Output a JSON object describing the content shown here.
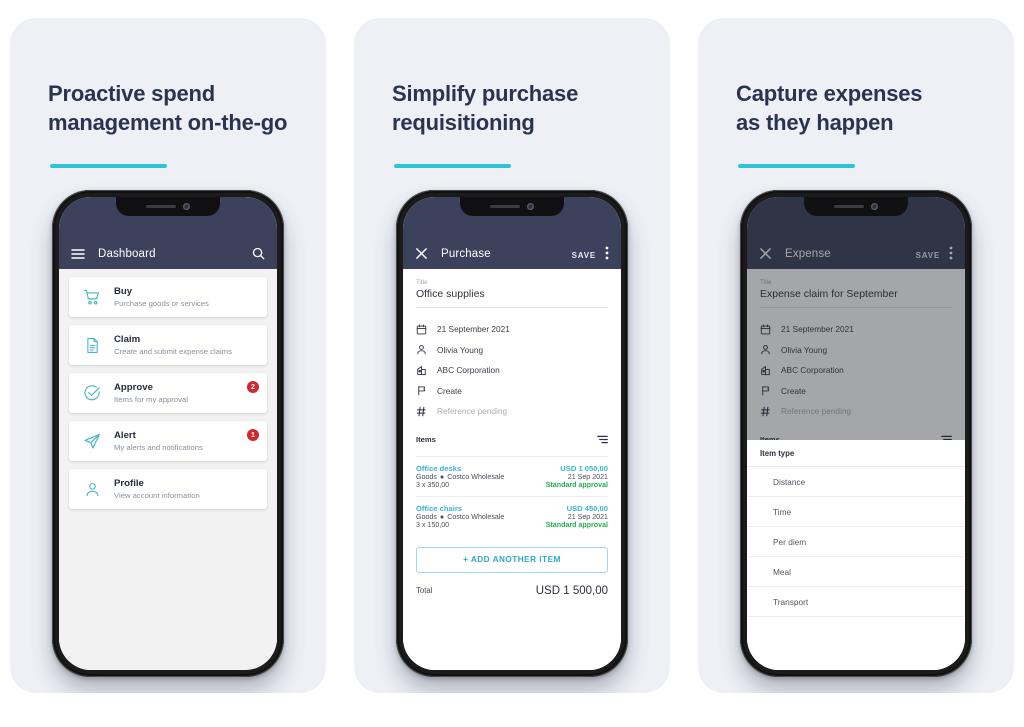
{
  "panels": [
    {
      "headline": "Proactive spend\nmanagement on-the-go",
      "screen": "dashboard",
      "appbar": {
        "title": "Dashboard",
        "menu_icon": "hamburger-icon",
        "search_icon": "search-icon"
      },
      "cards": [
        {
          "icon": "shopping-cart-icon",
          "title": "Buy",
          "subtitle": "Purchase goods or services",
          "badge": ""
        },
        {
          "icon": "document-icon",
          "title": "Claim",
          "subtitle": "Create and submit expense claims",
          "badge": ""
        },
        {
          "icon": "check-circle-icon",
          "title": "Approve",
          "subtitle": "Items for my approval",
          "badge": "2"
        },
        {
          "icon": "paper-plane-icon",
          "title": "Alert",
          "subtitle": "My alerts and notifications",
          "badge": "1"
        },
        {
          "icon": "person-icon",
          "title": "Profile",
          "subtitle": "View account information",
          "badge": ""
        }
      ]
    },
    {
      "headline": "Simplify purchase\nrequisitioning",
      "screen": "purchase",
      "appbar": {
        "close_icon": "close-icon",
        "title": "Purchase",
        "save_label": "SAVE",
        "overflow_icon": "more-vertical-icon"
      },
      "title_field": {
        "label": "Title",
        "value": "Office supplies"
      },
      "detail_rows": [
        {
          "icon": "calendar-icon",
          "text": "21 September 2021",
          "muted": false
        },
        {
          "icon": "person-icon",
          "text": "Olivia Young",
          "muted": false
        },
        {
          "icon": "building-icon",
          "text": "ABC Corporation",
          "muted": false
        },
        {
          "icon": "flag-icon",
          "text": "Create",
          "muted": false
        },
        {
          "icon": "hash-icon",
          "text": "Reference pending",
          "muted": true
        }
      ],
      "items_header": {
        "label": "Items",
        "sort_icon": "sort-filter-icon"
      },
      "items": [
        {
          "name": "Office desks",
          "amount": "USD 1 050,00",
          "category": "Goods",
          "vendor": "Costco Wholesale",
          "date": "21 Sep 2021",
          "quantity": "3 x 350,00",
          "status": "Standard approval"
        },
        {
          "name": "Office chairs",
          "amount": "USD 450,00",
          "category": "Goods",
          "vendor": "Costco Wholesale",
          "date": "21 Sep 2021",
          "quantity": "3 x 150,00",
          "status": "Standard approval"
        }
      ],
      "add_button": "+ ADD ANOTHER ITEM",
      "total": {
        "label": "Total",
        "value": "USD 1 500,00"
      }
    },
    {
      "headline": "Capture expenses\nas they happen",
      "screen": "expense",
      "appbar": {
        "close_icon": "close-icon",
        "title": "Expense",
        "save_label": "SAVE",
        "overflow_icon": "more-vertical-icon"
      },
      "title_field": {
        "label": "Title",
        "value": "Expense claim for September"
      },
      "detail_rows": [
        {
          "icon": "calendar-icon",
          "text": "21 September 2021",
          "muted": false
        },
        {
          "icon": "person-icon",
          "text": "Olivia Young",
          "muted": false
        },
        {
          "icon": "building-icon",
          "text": "ABC Corporation",
          "muted": false
        },
        {
          "icon": "flag-icon",
          "text": "Create",
          "muted": false
        },
        {
          "icon": "hash-icon",
          "text": "Reference pending",
          "muted": true
        }
      ],
      "items_header": {
        "label": "Items",
        "sort_icon": "sort-filter-icon"
      },
      "sheet": {
        "title": "Item type",
        "options": [
          "Distance",
          "Time",
          "Per diem",
          "Meal",
          "Transport"
        ]
      }
    }
  ],
  "colors": {
    "panel_bg": "#eef0f6",
    "headline": "#2b3350",
    "accent_rule": "#2ec5d9",
    "appbar": "#3c425c",
    "icon_teal": "#45b7c8",
    "link_teal": "#39b6cd",
    "status_green": "#25b04d",
    "badge_red": "#d0282e"
  }
}
